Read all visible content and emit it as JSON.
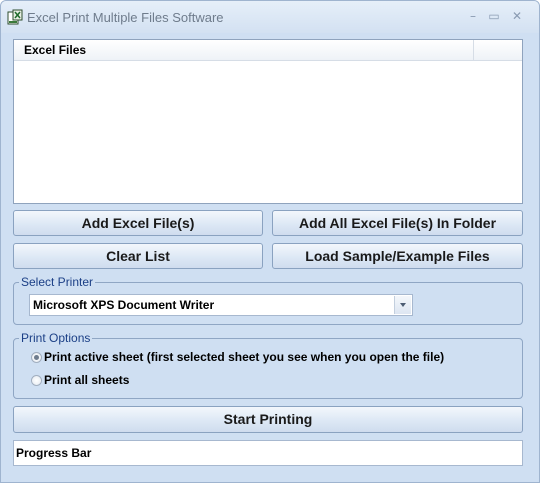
{
  "window": {
    "title": "Excel Print Multiple Files Software",
    "controls": {
      "minimize": "–",
      "maximize": "▭",
      "close": "✕"
    }
  },
  "file_list": {
    "column_header": "Excel Files",
    "items": []
  },
  "buttons": {
    "add_files": "Add Excel File(s)",
    "add_folder": "Add All Excel File(s) In Folder",
    "clear_list": "Clear List",
    "load_sample": "Load Sample/Example Files",
    "start_printing": "Start Printing"
  },
  "printer_group": {
    "legend": "Select Printer",
    "selected_printer": "Microsoft XPS Document Writer"
  },
  "print_options": {
    "legend": "Print Options",
    "options": [
      {
        "label": "Print active sheet (first selected sheet you see when you open the file)",
        "selected": true
      },
      {
        "label": "Print all sheets",
        "selected": false
      }
    ]
  },
  "progress": {
    "label": "Progress Bar",
    "value": 0
  }
}
